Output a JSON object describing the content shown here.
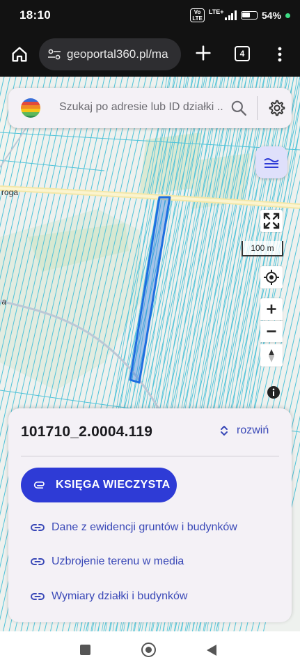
{
  "status_bar": {
    "time": "18:10",
    "volte": "Vo LTE",
    "network": "LTE+",
    "battery": "54%"
  },
  "browser": {
    "url": "geoportal360.pl/ma",
    "tab_count": "4"
  },
  "search": {
    "placeholder": "Szukaj po adresie lub ID działki ..."
  },
  "map": {
    "road_label_top": "roga",
    "road_label_left": "a",
    "scale_label": "100 m",
    "parcel_color": "#1e6ee0",
    "parcel_line_color": "#4fc3d9"
  },
  "card": {
    "parcel_id": "101710_2.0004.119",
    "expand_label": "rozwiń",
    "primary_button": "KSIĘGA WIECZYSTA",
    "links": [
      "Dane z ewidencji gruntów i budynków",
      "Uzbrojenie terenu w media",
      "Wymiary działki i budynków"
    ]
  },
  "colors": {
    "accent": "#2e3bd6",
    "link": "#3948b7",
    "card_bg": "#f4f1f6"
  }
}
